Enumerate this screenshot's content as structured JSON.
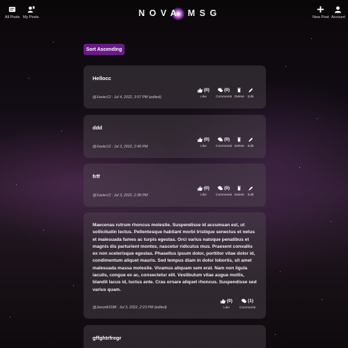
{
  "header": {
    "logo_text": "NOVA MSG",
    "left_nav": [
      {
        "label": "All Posts",
        "icon": "posts-icon"
      },
      {
        "label": "My Posts",
        "icon": "user-posts-icon"
      }
    ],
    "right_nav": [
      {
        "label": "New Post",
        "icon": "plus-icon"
      },
      {
        "label": "Account",
        "icon": "account-icon"
      }
    ]
  },
  "sort_button": "Sort Ascending",
  "actions": {
    "like": "Like",
    "comments": "Comments",
    "delete": "Delete",
    "edit": "Edit"
  },
  "posts": [
    {
      "title": "Hellocc",
      "meta": "@Xavier12 : Jul 4, 2022, 3:57 PM (edited)",
      "likes": "(0)",
      "comments": "(0)"
    },
    {
      "title": "ddd",
      "meta": "@Xavier12 : Jul 3, 2022, 2:49 PM",
      "likes": "(0)",
      "comments": "(0)"
    },
    {
      "title": "frff",
      "meta": "@Xavier12 : Jul 3, 2022, 2:38 PM",
      "likes": "(0)",
      "comments": "(0)"
    },
    {
      "body": "Maecenas rutrum rhoncus molestie. Suspendisse id accumsan est, ut sollicitudin lectus. Pellentesque habitant morbi tristique senectus et netus et malesuada fames ac turpis egestas. Orci varius natoque penatibus et magnis dis parturient montes, nascetur ridiculus mus. Praesent convallis ex non scelerisque egestas. Phasellus ipsum dolor, porttitor vitae dolor id, condimentum aliquet mauris. Sed tempus diam in dolor lobortis, sit amet malesuada massa molestie. Vivamus aliquam sem erat. Nam non ligula iaculis, congue ex ac, consectetur elit. Vestibulum vitae augue mollis, blandit lacus id, luctus ante. Cras ornare aliquet rhoncus. Suspendisse sed varius quam.",
      "meta": "@Jason81098 : Jul 3, 2022, 2:23 PM (edited)",
      "likes": "(0)",
      "comments": "(1)"
    },
    {
      "title": "gffghtrfregr"
    }
  ]
}
